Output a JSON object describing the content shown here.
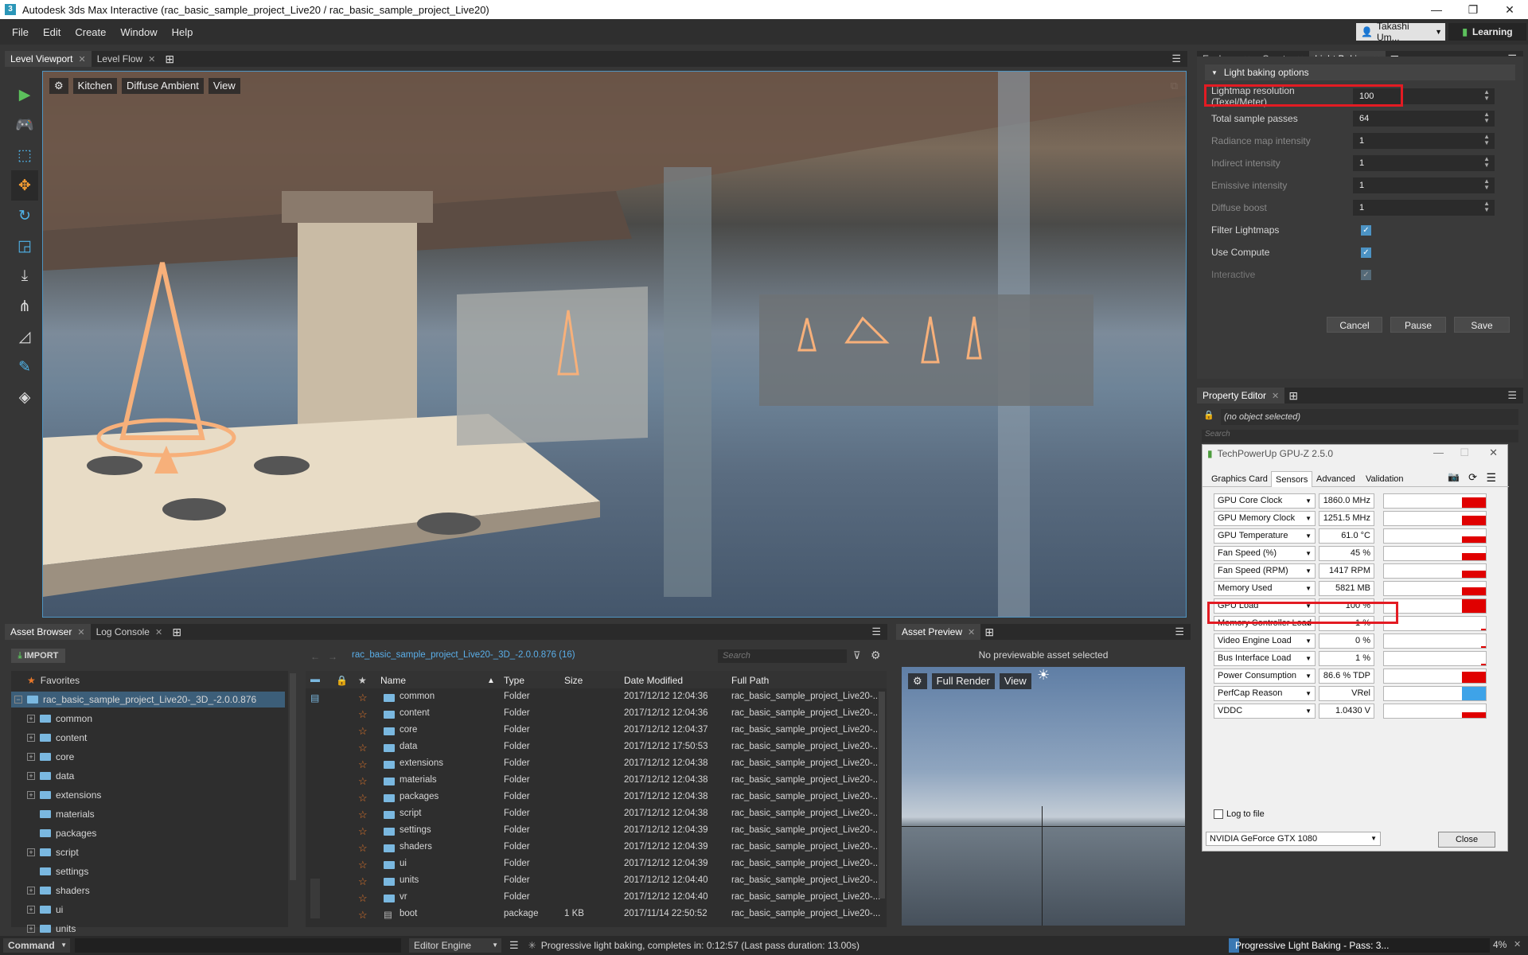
{
  "app": {
    "title": "Autodesk 3ds Max Interactive (rac_basic_sample_project_Live20 / rac_basic_sample_project_Live20)",
    "logo": "3",
    "min": "—",
    "max": "❐",
    "close": "✕"
  },
  "menu": [
    "File",
    "Edit",
    "Create",
    "Window",
    "Help"
  ],
  "user": {
    "name": "Takashi Um...",
    "learning": "Learning"
  },
  "viewport_tabs": [
    "Level Viewport",
    "Level Flow"
  ],
  "viewport": {
    "camera": "Kitchen",
    "mode": "Diffuse Ambient",
    "view": "View"
  },
  "right_tabs": [
    "Explorer",
    "Create",
    "Light Baking"
  ],
  "light_baking": {
    "header": "Light baking options",
    "rows": [
      {
        "label": "Lightmap resolution (Texel/Meter)",
        "value": "100"
      },
      {
        "label": "Total sample passes",
        "value": "64"
      },
      {
        "label": "Radiance map intensity",
        "value": "1"
      },
      {
        "label": "Indirect intensity",
        "value": "1"
      },
      {
        "label": "Emissive intensity",
        "value": "1"
      },
      {
        "label": "Diffuse boost",
        "value": "1"
      }
    ],
    "checks": [
      {
        "label": "Filter Lightmaps",
        "checked": true
      },
      {
        "label": "Use Compute",
        "checked": true
      },
      {
        "label": "Interactive",
        "checked": true
      }
    ],
    "cancel": "Cancel",
    "pause": "Pause",
    "save": "Save"
  },
  "property_editor": {
    "tab": "Property Editor",
    "status": "(no object selected)",
    "search": "Search"
  },
  "gpuz": {
    "title": "TechPowerUp GPU-Z 2.5.0",
    "tabs": [
      "Graphics Card",
      "Sensors",
      "Advanced",
      "Validation"
    ],
    "sensors": [
      {
        "name": "GPU Core Clock",
        "value": "1860.0 MHz",
        "level": 0.75
      },
      {
        "name": "GPU Memory Clock",
        "value": "1251.5 MHz",
        "level": 0.7
      },
      {
        "name": "GPU Temperature",
        "value": "61.0 °C",
        "level": 0.45
      },
      {
        "name": "Fan Speed (%)",
        "value": "45 %",
        "level": 0.5
      },
      {
        "name": "Fan Speed (RPM)",
        "value": "1417 RPM",
        "level": 0.5
      },
      {
        "name": "Memory Used",
        "value": "5821 MB",
        "level": 0.55
      },
      {
        "name": "GPU Load",
        "value": "100 %",
        "level": 1.0
      },
      {
        "name": "Memory Controller Load",
        "value": "1 %",
        "level": 0.02
      },
      {
        "name": "Video Engine Load",
        "value": "0 %",
        "level": 0.0
      },
      {
        "name": "Bus Interface Load",
        "value": "1 %",
        "level": 0.02
      },
      {
        "name": "Power Consumption",
        "value": "86.6 % TDP",
        "level": 0.8
      },
      {
        "name": "PerfCap Reason",
        "value": "VRel",
        "level": 1.0
      },
      {
        "name": "VDDC",
        "value": "1.0430 V",
        "level": 0.4
      }
    ],
    "log": "Log to file",
    "gpu": "NVIDIA GeForce GTX 1080",
    "close": "Close"
  },
  "asset_browser": {
    "tabs": [
      "Asset Browser",
      "Log Console"
    ],
    "import": "IMPORT",
    "path": "rac_basic_sample_project_Live20-_3D_-2.0.0.876 (16)",
    "search": "Search",
    "favorites": "Favorites",
    "root": "rac_basic_sample_project_Live20-_3D_-2.0.0.876",
    "tree": [
      "common",
      "content",
      "core",
      "data",
      "extensions",
      "materials",
      "packages",
      "script",
      "settings",
      "shaders",
      "ui",
      "units"
    ],
    "columns": [
      "Name",
      "Type",
      "Size",
      "Date Modified",
      "Full Path"
    ],
    "files": [
      {
        "name": "common",
        "type": "Folder",
        "size": "",
        "date": "2017/12/12 12:04:36",
        "path": "rac_basic_sample_project_Live20-..."
      },
      {
        "name": "content",
        "type": "Folder",
        "size": "",
        "date": "2017/12/12 12:04:36",
        "path": "rac_basic_sample_project_Live20-..."
      },
      {
        "name": "core",
        "type": "Folder",
        "size": "",
        "date": "2017/12/12 12:04:37",
        "path": "rac_basic_sample_project_Live20-..."
      },
      {
        "name": "data",
        "type": "Folder",
        "size": "",
        "date": "2017/12/12 17:50:53",
        "path": "rac_basic_sample_project_Live20-..."
      },
      {
        "name": "extensions",
        "type": "Folder",
        "size": "",
        "date": "2017/12/12 12:04:38",
        "path": "rac_basic_sample_project_Live20-..."
      },
      {
        "name": "materials",
        "type": "Folder",
        "size": "",
        "date": "2017/12/12 12:04:38",
        "path": "rac_basic_sample_project_Live20-..."
      },
      {
        "name": "packages",
        "type": "Folder",
        "size": "",
        "date": "2017/12/12 12:04:38",
        "path": "rac_basic_sample_project_Live20-..."
      },
      {
        "name": "script",
        "type": "Folder",
        "size": "",
        "date": "2017/12/12 12:04:38",
        "path": "rac_basic_sample_project_Live20-..."
      },
      {
        "name": "settings",
        "type": "Folder",
        "size": "",
        "date": "2017/12/12 12:04:39",
        "path": "rac_basic_sample_project_Live20-..."
      },
      {
        "name": "shaders",
        "type": "Folder",
        "size": "",
        "date": "2017/12/12 12:04:39",
        "path": "rac_basic_sample_project_Live20-..."
      },
      {
        "name": "ui",
        "type": "Folder",
        "size": "",
        "date": "2017/12/12 12:04:39",
        "path": "rac_basic_sample_project_Live20-..."
      },
      {
        "name": "units",
        "type": "Folder",
        "size": "",
        "date": "2017/12/12 12:04:40",
        "path": "rac_basic_sample_project_Live20-..."
      },
      {
        "name": "vr",
        "type": "Folder",
        "size": "",
        "date": "2017/12/12 12:04:40",
        "path": "rac_basic_sample_project_Live20-..."
      },
      {
        "name": "boot",
        "type": "package",
        "size": "1 KB",
        "date": "2017/11/14 22:50:52",
        "path": "rac_basic_sample_project_Live20-..."
      }
    ]
  },
  "asset_preview": {
    "tab": "Asset Preview",
    "msg": "No previewable asset selected",
    "mode": "Full Render",
    "view": "View"
  },
  "status": {
    "command": "Command",
    "engine": "Editor Engine",
    "progress": "Progressive light baking, completes in: 0:12:57 (Last pass duration: 13.00s)",
    "pass": "Progressive Light Baking - Pass: 3...",
    "percent": "4%",
    "percent_value": 0.04
  }
}
